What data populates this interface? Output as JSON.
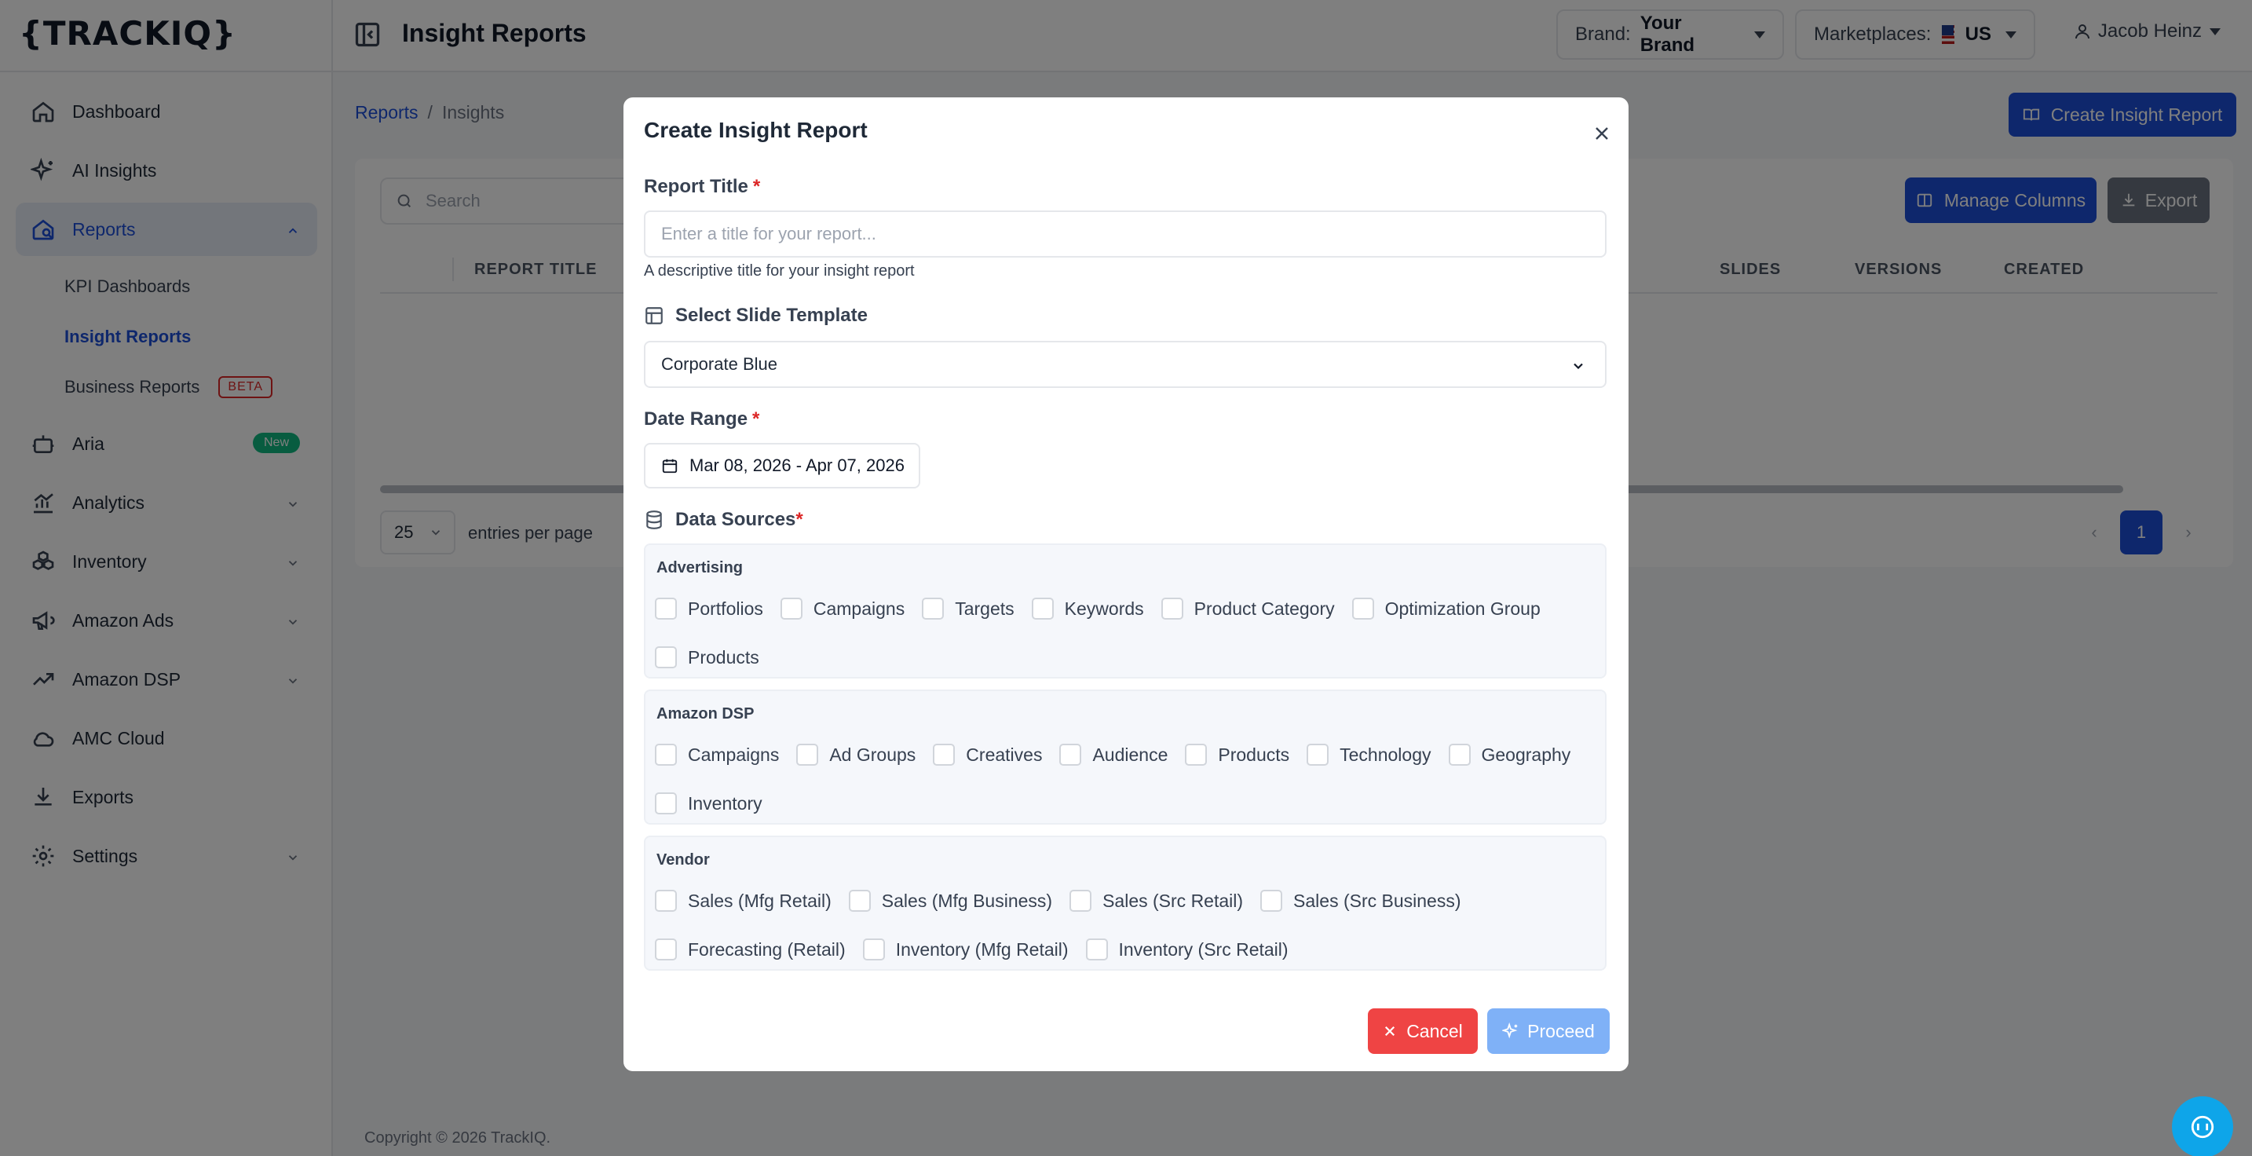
{
  "app": {
    "logo": "{TRACKIQ}",
    "page_title": "Insight Reports"
  },
  "sidebar": {
    "items": [
      {
        "label": "Dashboard",
        "icon": "home-icon"
      },
      {
        "label": "AI Insights",
        "icon": "sparkles-icon"
      },
      {
        "label": "Reports",
        "icon": "reports-icon",
        "active": true
      },
      {
        "label": "Aria",
        "icon": "robot-icon",
        "badge": "New"
      },
      {
        "label": "Analytics",
        "icon": "analytics-icon"
      },
      {
        "label": "Inventory",
        "icon": "boxes-icon"
      },
      {
        "label": "Amazon Ads",
        "icon": "megaphone-icon"
      },
      {
        "label": "Amazon DSP",
        "icon": "trending-icon"
      },
      {
        "label": "AMC Cloud",
        "icon": "cloud-icon"
      },
      {
        "label": "Exports",
        "icon": "download-icon"
      },
      {
        "label": "Settings",
        "icon": "gear-icon"
      }
    ],
    "reports_sub": [
      {
        "label": "KPI Dashboards"
      },
      {
        "label": "Insight Reports",
        "active": true
      },
      {
        "label": "Business Reports",
        "badge": "BETA"
      }
    ]
  },
  "header": {
    "brand_label": "Brand:",
    "brand_value": "Your Brand",
    "marketplaces_label": "Marketplaces:",
    "marketplace_value": "US",
    "user_name": "Jacob Heinz"
  },
  "main": {
    "breadcrumb": {
      "root": "Reports",
      "separator": "/",
      "current": "Insights"
    },
    "create_button": "Create Insight Report",
    "search_placeholder": "Search",
    "manage_columns_button": "Manage Columns",
    "export_button": "Export",
    "columns": [
      "REPORT TITLE",
      "SLIDES",
      "VERSIONS",
      "CREATED"
    ],
    "per_page_value": "25",
    "per_page_label": "entries per page",
    "current_page": "1",
    "footer": "Copyright © 2026 TrackIQ."
  },
  "modal": {
    "title": "Create Insight Report",
    "report_title_label": "Report Title",
    "report_title_placeholder": "Enter a title for your report...",
    "report_title_value": "",
    "report_title_hint": "A descriptive title for your insight report",
    "template_label": "Select Slide Template",
    "template_value": "Corporate Blue",
    "date_range_label": "Date Range",
    "date_range_value": "Mar 08, 2026 - Apr 07, 2026",
    "data_sources_label": "Data Sources",
    "required_mark": "*",
    "groups": [
      {
        "title": "Advertising",
        "items": [
          "Portfolios",
          "Campaigns",
          "Targets",
          "Keywords",
          "Product Category",
          "Optimization Group",
          "Products"
        ]
      },
      {
        "title": "Amazon DSP",
        "items": [
          "Campaigns",
          "Ad Groups",
          "Creatives",
          "Audience",
          "Products",
          "Technology",
          "Geography",
          "Inventory"
        ]
      },
      {
        "title": "Vendor",
        "items": [
          "Sales (Mfg Retail)",
          "Sales (Mfg Business)",
          "Sales (Src Retail)",
          "Sales (Src Business)",
          "Forecasting (Retail)",
          "Inventory (Mfg Retail)",
          "Inventory (Src Retail)"
        ]
      }
    ],
    "cancel_button": "Cancel",
    "proceed_button": "Proceed"
  },
  "colors": {
    "primary": "#1d4ed8",
    "danger": "#ef4444",
    "proceed_disabled": "#7fb1f7",
    "overlay": "rgba(0,0,0,0.5)"
  }
}
